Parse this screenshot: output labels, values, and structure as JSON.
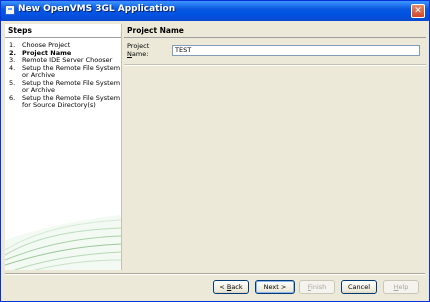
{
  "window": {
    "title": "New OpenVMS 3GL Application",
    "close_glyph": "✕"
  },
  "steps": {
    "heading": "Steps",
    "items": [
      {
        "num": "1.",
        "label": "Choose Project"
      },
      {
        "num": "2.",
        "label": "Project Name",
        "current": true
      },
      {
        "num": "3.",
        "label": "Remote IDE Server Chooser"
      },
      {
        "num": "4.",
        "label": "Setup the Remote File System or Archive"
      },
      {
        "num": "5.",
        "label": "Setup the Remote File System or Archive"
      },
      {
        "num": "6.",
        "label": "Setup the Remote File System for Source Directory(s)"
      }
    ]
  },
  "content": {
    "heading": "Project Name",
    "project_name_label_pre": "Project ",
    "project_name_label_u": "N",
    "project_name_label_post": "ame:",
    "project_name_value": "TEST"
  },
  "buttons": {
    "back_pre": "< ",
    "back_u": "B",
    "back_post": "ack",
    "next": "Next >",
    "finish_u": "F",
    "finish_post": "inish",
    "cancel": "Cancel",
    "help_u": "H",
    "help_post": "elp"
  }
}
